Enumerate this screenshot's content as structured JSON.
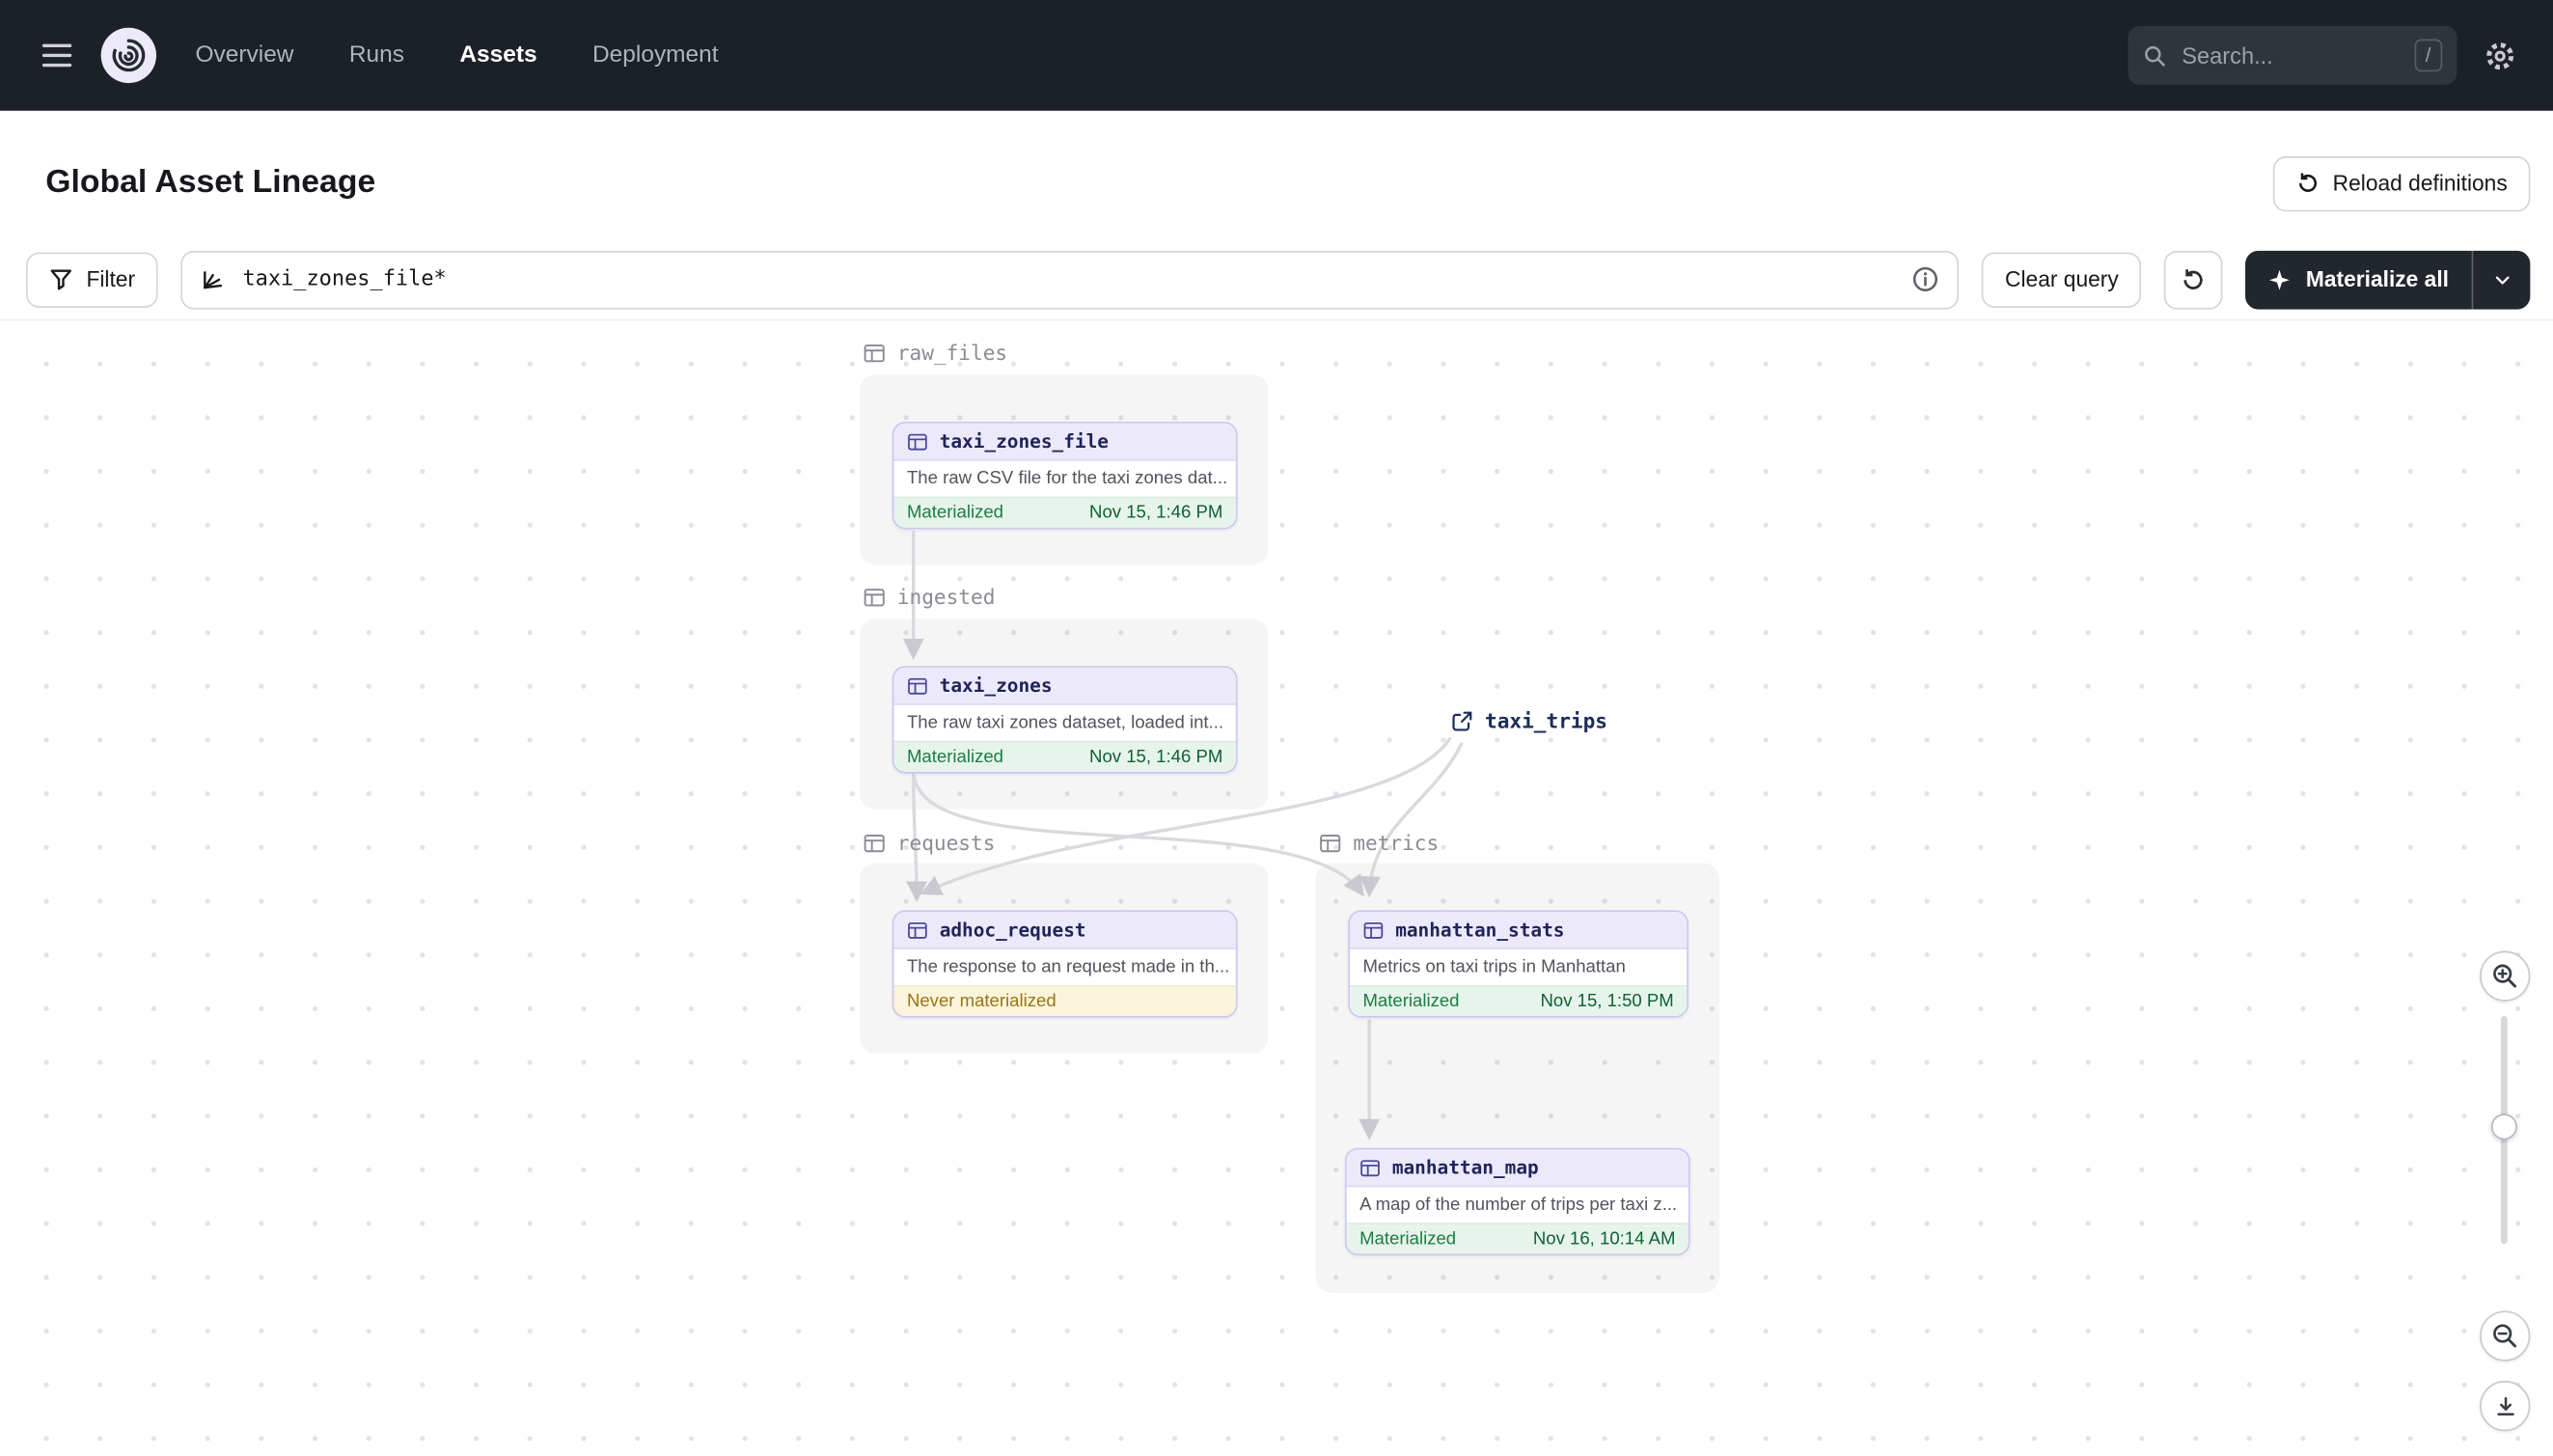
{
  "nav": {
    "items": [
      {
        "label": "Overview",
        "active": false
      },
      {
        "label": "Runs",
        "active": false
      },
      {
        "label": "Assets",
        "active": true
      },
      {
        "label": "Deployment",
        "active": false
      }
    ],
    "search_placeholder": "Search...",
    "search_shortcut": "/"
  },
  "header": {
    "title": "Global Asset Lineage",
    "reload_button": "Reload definitions"
  },
  "toolbar": {
    "filter_label": "Filter",
    "query_value": "taxi_zones_file*",
    "clear_button": "Clear query",
    "materialize_button": "Materialize all"
  },
  "graph": {
    "groups": [
      {
        "name": "raw_files"
      },
      {
        "name": "ingested"
      },
      {
        "name": "requests"
      },
      {
        "name": "metrics"
      }
    ],
    "nodes": [
      {
        "name": "taxi_zones_file",
        "description": "The raw CSV file for the taxi zones dat...",
        "status": "Materialized",
        "timestamp": "Nov 15, 1:46 PM",
        "status_type": "materialized",
        "group": "raw_files"
      },
      {
        "name": "taxi_zones",
        "description": "The raw taxi zones dataset, loaded int...",
        "status": "Materialized",
        "timestamp": "Nov 15, 1:46 PM",
        "status_type": "materialized",
        "group": "ingested"
      },
      {
        "name": "adhoc_request",
        "description": "The response to an request made in th...",
        "status": "Never materialized",
        "timestamp": "",
        "status_type": "never_materialized",
        "group": "requests"
      },
      {
        "name": "manhattan_stats",
        "description": "Metrics on taxi trips in Manhattan",
        "status": "Materialized",
        "timestamp": "Nov 15, 1:50 PM",
        "status_type": "materialized",
        "group": "metrics"
      },
      {
        "name": "manhattan_map",
        "description": "A map of the number of trips per taxi z...",
        "status": "Materialized",
        "timestamp": "Nov 16, 10:14 AM",
        "status_type": "materialized",
        "group": "metrics"
      }
    ],
    "external_node": {
      "name": "taxi_trips"
    },
    "edges": [
      "taxi_zones_file -> taxi_zones",
      "taxi_zones -> adhoc_request",
      "taxi_zones -> manhattan_stats",
      "taxi_trips -> adhoc_request",
      "taxi_trips -> manhattan_stats",
      "manhattan_stats -> manhattan_map"
    ]
  },
  "icons": [
    "menu-icon",
    "dagster-logo",
    "search-icon",
    "settings-gear-icon",
    "reload-icon",
    "filter-funnel-icon",
    "lineage-query-icon",
    "info-icon",
    "refresh-icon",
    "sparkle-icon",
    "chevron-down-icon",
    "table-icon",
    "external-link-icon",
    "zoom-in-icon",
    "zoom-out-icon",
    "download-icon"
  ],
  "colors": {
    "navbar_bg": "#1C2127",
    "card_border": "#CBC7EF",
    "card_header_bg": "#ECEAFA",
    "materialized_green": "#1C7C44",
    "never_materialized_amber": "#977614",
    "materialize_button_bg": "#22262D"
  }
}
